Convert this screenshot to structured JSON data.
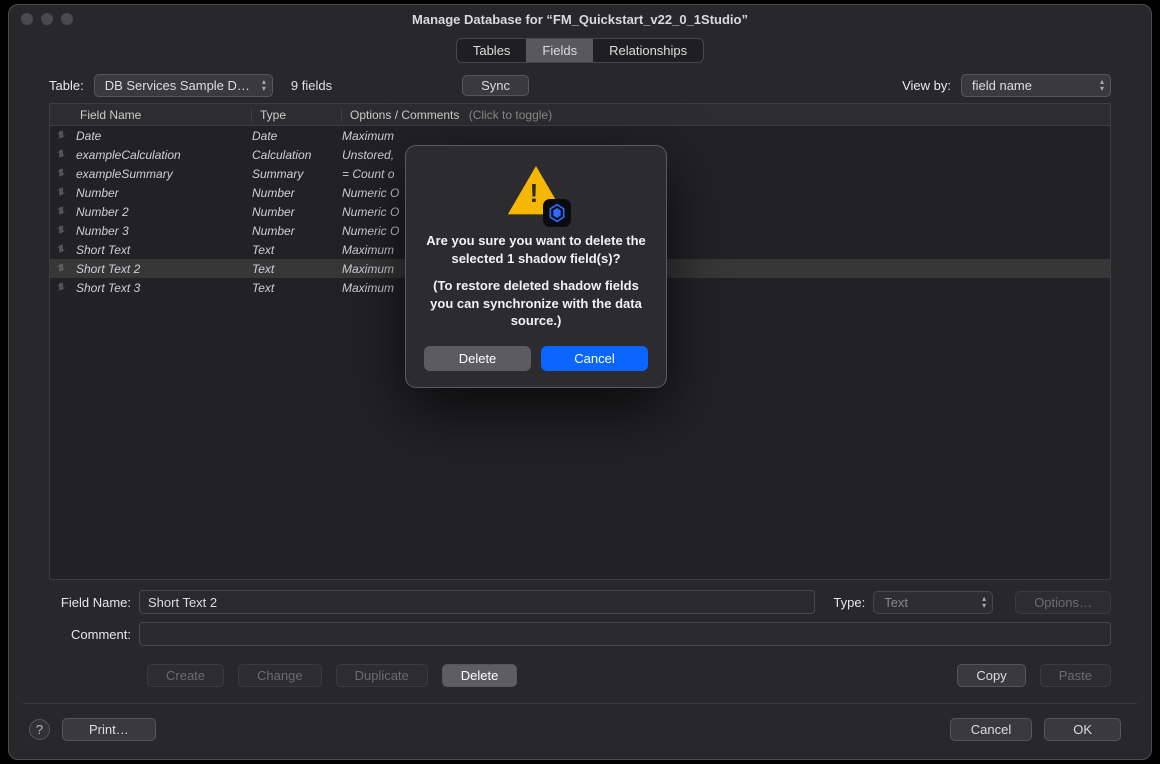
{
  "window_title": "Manage Database for “FM_Quickstart_v22_0_1Studio”",
  "tabs": {
    "tables": "Tables",
    "fields": "Fields",
    "relationships": "Relationships"
  },
  "toolbar": {
    "table_label": "Table:",
    "table_value": "DB Services Sample D…",
    "count": "9 fields",
    "sync": "Sync",
    "viewby_label": "View by:",
    "viewby_value": "field name"
  },
  "headers": {
    "name": "Field Name",
    "type": "Type",
    "options": "Options / Comments",
    "toggle": "(Click to toggle)"
  },
  "rows": [
    {
      "name": "Date",
      "type": "Date",
      "options": "Maximum"
    },
    {
      "name": "exampleCalculation",
      "type": "Calculation",
      "options": "Unstored,"
    },
    {
      "name": "exampleSummary",
      "type": "Summary",
      "options": "= Count o"
    },
    {
      "name": "Number",
      "type": "Number",
      "options": "Numeric O"
    },
    {
      "name": "Number 2",
      "type": "Number",
      "options": "Numeric O"
    },
    {
      "name": "Number 3",
      "type": "Number",
      "options": "Numeric O"
    },
    {
      "name": "Short Text",
      "type": "Text",
      "options": "Maximum"
    },
    {
      "name": "Short Text 2",
      "type": "Text",
      "options": "Maximum"
    },
    {
      "name": "Short Text 3",
      "type": "Text",
      "options": "Maximum"
    }
  ],
  "selected_row_index": 7,
  "form": {
    "fieldname_label": "Field Name:",
    "fieldname_value": "Short Text 2",
    "type_label": "Type:",
    "type_value": "Text",
    "options_btn": "Options…",
    "comment_label": "Comment:",
    "comment_value": ""
  },
  "actions": {
    "create": "Create",
    "change": "Change",
    "duplicate": "Duplicate",
    "delete": "Delete",
    "copy": "Copy",
    "paste": "Paste"
  },
  "footer": {
    "print": "Print…",
    "cancel": "Cancel",
    "ok": "OK"
  },
  "modal": {
    "line1": "Are you sure you want to delete the selected 1 shadow field(s)?",
    "line2": "(To restore deleted shadow fields you can synchronize with the data source.)",
    "delete": "Delete",
    "cancel": "Cancel"
  }
}
